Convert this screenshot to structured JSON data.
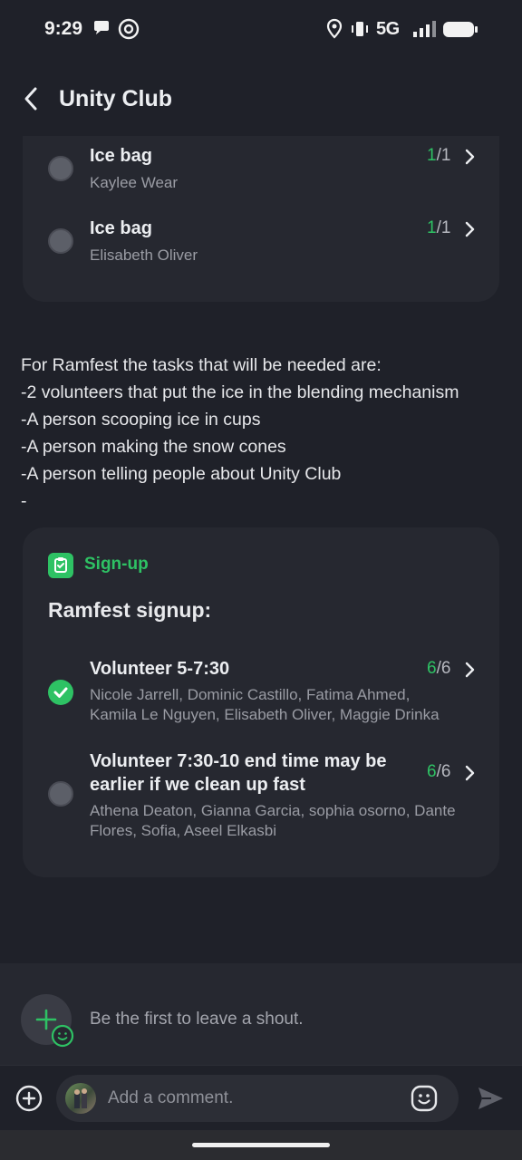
{
  "status": {
    "time": "9:29",
    "network": "5G"
  },
  "header": {
    "title": "Unity Club"
  },
  "top_tasks": [
    {
      "title": "Ice bag",
      "names": "Kaylee Wear",
      "done": "1",
      "total": "/1"
    },
    {
      "title": "Ice bag",
      "names": "Elisabeth Oliver",
      "done": "1",
      "total": "/1"
    }
  ],
  "post": {
    "lines": [
      "For Ramfest the tasks that will be needed are:",
      "-2 volunteers that put the ice in the blending mechanism",
      "-A person scooping ice in cups",
      "-A person making the snow cones",
      "-A person telling people about Unity Club",
      "-"
    ]
  },
  "signup": {
    "label": "Sign-up",
    "title": "Ramfest signup:",
    "tasks": [
      {
        "title": "Volunteer 5-7:30",
        "names_1": "Nicole Jarrell, Dominic Castillo, Fatima Ahmed,",
        "names_2": "Kamila Le Nguyen, Elisabeth Oliver, Maggie Drinka",
        "done": "6",
        "total": "/6",
        "checked": true
      },
      {
        "title_1": "Volunteer 7:30-10 end time may be",
        "title_2": "earlier if we clean up fast",
        "names_1": "Athena Deaton, Gianna Garcia, sophia osorno, Dante",
        "names_2": "Flores, Sofia, Aseel Elkasbi",
        "done": "6",
        "total": "/6",
        "checked": false
      }
    ]
  },
  "shout": {
    "placeholder": "Be the first to leave a shout."
  },
  "composer": {
    "placeholder": "Add a comment."
  },
  "colors": {
    "accent": "#2ec264",
    "background": "#1f2129",
    "card": "#262830"
  }
}
